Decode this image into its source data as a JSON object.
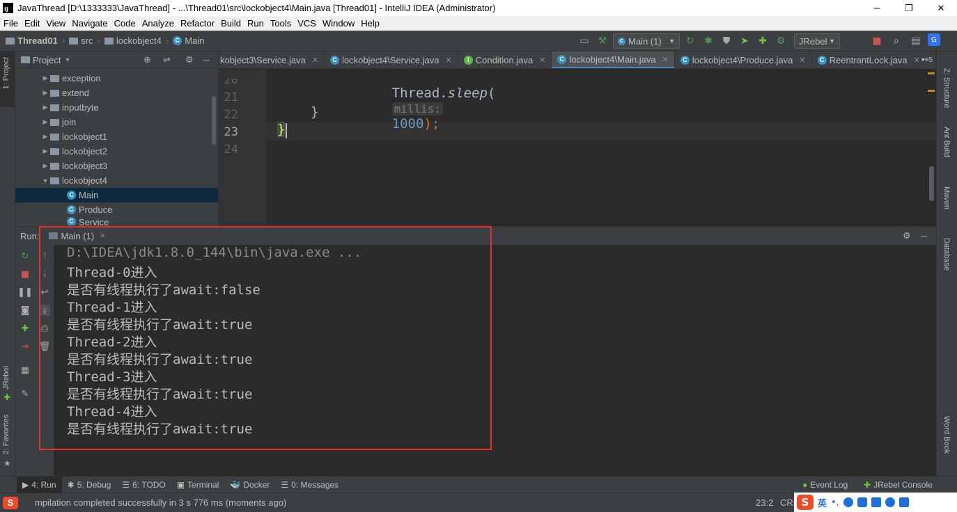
{
  "window": {
    "title": "JavaThread [D:\\1333333\\JavaThread] - ...\\Thread01\\src\\lockobject4\\Main.java [Thread01] - IntelliJ IDEA (Administrator)",
    "app_icon_text": "IJ",
    "minimize": "─",
    "restore": "❐",
    "close": "✕"
  },
  "menu": [
    "File",
    "Edit",
    "View",
    "Navigate",
    "Code",
    "Analyze",
    "Refactor",
    "Build",
    "Run",
    "Tools",
    "VCS",
    "Window",
    "Help"
  ],
  "breadcrumb": [
    "Thread01",
    "src",
    "lockobject4",
    "Main"
  ],
  "toolbar": {
    "run_config": "Main (1)",
    "jrebel": "JRebel"
  },
  "left_stripe": {
    "project": "1: Project",
    "jrebel": "JRebel",
    "favorites": "2: Favorites"
  },
  "right_stripe": {
    "structure": "Z: Structure",
    "ant": "Ant Build",
    "maven": "Maven",
    "database": "Database",
    "wordbook": "Word Book"
  },
  "project_panel": {
    "title": "Project",
    "items": [
      {
        "label": "exception",
        "type": "folder",
        "depth": 1,
        "expanded": false
      },
      {
        "label": "extend",
        "type": "folder",
        "depth": 1,
        "expanded": false
      },
      {
        "label": "inputbyte",
        "type": "folder",
        "depth": 1,
        "expanded": false
      },
      {
        "label": "join",
        "type": "folder",
        "depth": 1,
        "expanded": false
      },
      {
        "label": "lockobject1",
        "type": "folder",
        "depth": 1,
        "expanded": false
      },
      {
        "label": "lockobject2",
        "type": "folder",
        "depth": 1,
        "expanded": false
      },
      {
        "label": "lockobject3",
        "type": "folder",
        "depth": 1,
        "expanded": false
      },
      {
        "label": "lockobject4",
        "type": "folder",
        "depth": 1,
        "expanded": true
      },
      {
        "label": "Main",
        "type": "class",
        "depth": 2,
        "selected": true
      },
      {
        "label": "Produce",
        "type": "class",
        "depth": 2
      },
      {
        "label": "Service",
        "type": "class",
        "depth": 2
      }
    ]
  },
  "editor_tabs": [
    {
      "label": "kobject3\\Service.java",
      "active": false
    },
    {
      "label": "lockobject4\\Service.java",
      "active": false
    },
    {
      "label": "Condition.java",
      "active": false
    },
    {
      "label": "lockobject4\\Main.java",
      "active": true
    },
    {
      "label": "lockobject4\\Produce.java",
      "active": false
    },
    {
      "label": "ReentrantLock.java",
      "active": false
    }
  ],
  "editor_tabs_overflow": "5",
  "code": {
    "line_numbers": [
      "20",
      "21",
      "22",
      "23",
      "24"
    ],
    "line20_prefix": "Thread.",
    "line20_method": "sleep",
    "line20_paren": "(",
    "line20_hint": "millis:",
    "line20_value": "1000",
    "line20_end": ");",
    "line22": "}",
    "line23": "}"
  },
  "run_panel": {
    "label": "Run:",
    "tab": "Main (1)",
    "console": [
      "D:\\IDEA\\jdk1.8.0_144\\bin\\java.exe ...",
      "Thread-0进入",
      "是否有线程执行了await:false",
      "Thread-1进入",
      "是否有线程执行了await:true",
      "Thread-2进入",
      "是否有线程执行了await:true",
      "Thread-3进入",
      "是否有线程执行了await:true",
      "Thread-4进入",
      "是否有线程执行了await:true"
    ]
  },
  "bottom_tabs": [
    {
      "label": "4: Run",
      "active": true
    },
    {
      "label": "5: Debug"
    },
    {
      "label": "6: TODO"
    },
    {
      "label": "Terminal"
    },
    {
      "label": "Docker"
    },
    {
      "label": "0: Messages"
    }
  ],
  "bottom_right_tabs": [
    "Event Log",
    "JRebel Console"
  ],
  "status": {
    "message": "mpilation completed successfully in 3 s 776 ms (moments ago)",
    "position": "23:2",
    "crlf": "CRL",
    "ime_lang": "英"
  },
  "colors": {
    "accent": "#4a88c7",
    "highlight_border": "#e83030",
    "run_green": "#499c54",
    "stop_red": "#c75450"
  }
}
